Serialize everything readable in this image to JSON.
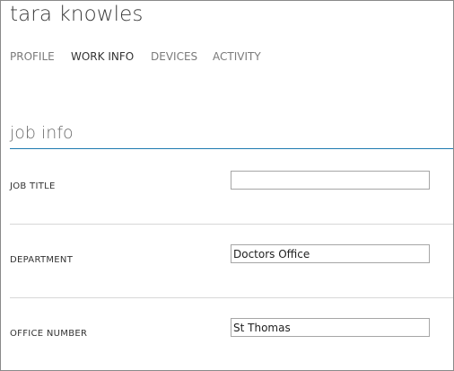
{
  "user": {
    "name": "tara knowles"
  },
  "tabs": [
    {
      "label": "PROFILE",
      "active": false
    },
    {
      "label": "WORK INFO",
      "active": true
    },
    {
      "label": "DEVICES",
      "active": false
    },
    {
      "label": "ACTIVITY",
      "active": false
    }
  ],
  "section": {
    "title": "job info"
  },
  "fields": {
    "job_title": {
      "label": "JOB TITLE",
      "value": ""
    },
    "department": {
      "label": "DEPARTMENT",
      "value": "Doctors Office"
    },
    "office_number": {
      "label": "OFFICE NUMBER",
      "value": "St Thomas"
    }
  },
  "colors": {
    "accent_rule": "#1f7bb0",
    "active_tab": "#333333",
    "inactive_tab": "#7a7a7a"
  }
}
